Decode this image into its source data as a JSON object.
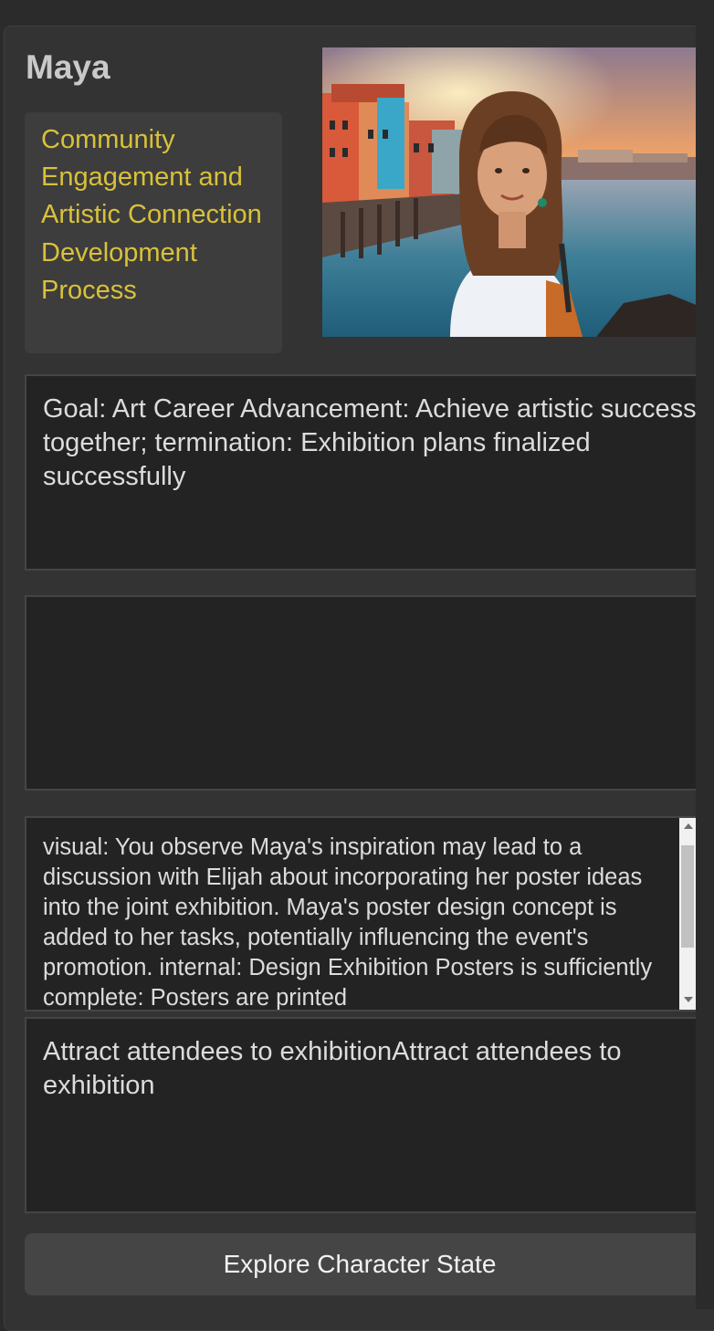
{
  "character": {
    "name": "Maya",
    "plan": "Community Engagement and Artistic Connection Development Process",
    "portrait_alt": "Portrait of Maya by a waterfront at sunset"
  },
  "goal_text": "Goal: Art Career Advancement: Achieve artistic success together; termination: Exhibition plans finalized successfully",
  "empty_panel_text": "",
  "observation_text": "visual: You observe Maya's inspiration may lead to a discussion with Elijah about incorporating her poster ideas into the joint exhibition. Maya's poster design concept is added to her tasks, potentially influencing the event's promotion. internal: Design Exhibition Posters is sufficiently complete: Posters are printed",
  "purpose_text": "Attract attendees to exhibitionAttract attendees to exhibition",
  "explore_button_label": "Explore Character State",
  "colors": {
    "background": "#2b2b2b",
    "panel": "#333333",
    "plan_text": "#d9c13a",
    "text_box": "#232323",
    "button": "#454545"
  }
}
